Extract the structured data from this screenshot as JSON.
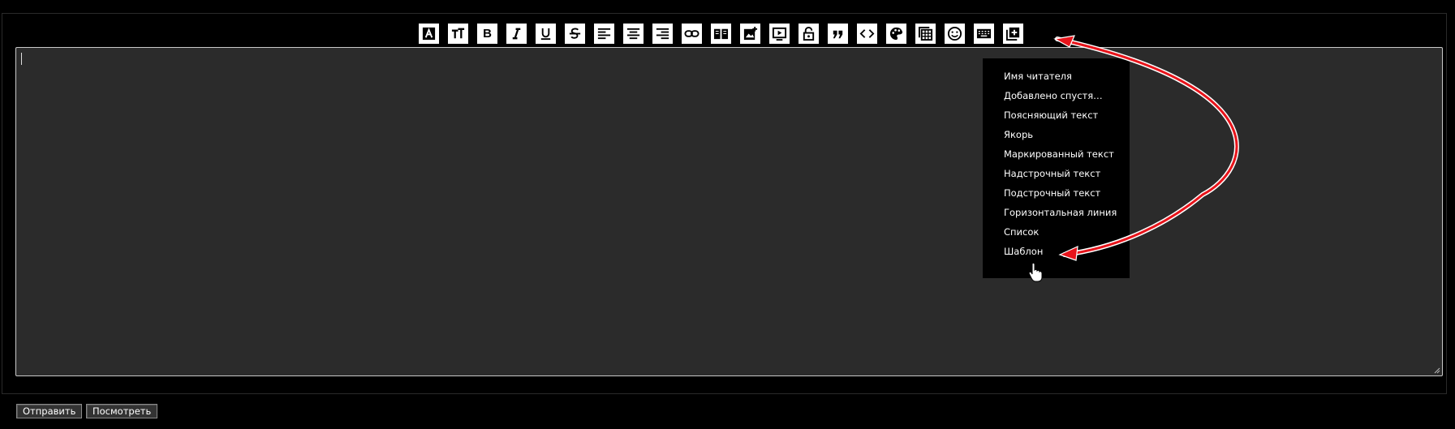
{
  "toolbar": {
    "icons": [
      "font-color-icon",
      "text-size-icon",
      "bold-icon",
      "italic-icon",
      "underline-icon",
      "strikethrough-icon",
      "align-left-icon",
      "align-center-icon",
      "align-right-icon",
      "link-icon",
      "book-icon",
      "image-add-icon",
      "video-icon",
      "lock-icon",
      "quote-icon",
      "code-icon",
      "palette-icon",
      "table-icon",
      "emoji-icon",
      "keyboard-icon",
      "more-add-icon"
    ],
    "bold_glyph": "B",
    "italic_glyph": "I",
    "underline_glyph": "U",
    "strike_glyph": "S"
  },
  "menu": {
    "items": [
      "Имя читателя",
      "Добавлено спустя…",
      "Поясняющий текст",
      "Якорь",
      "Маркированный текст",
      "Надстрочный текст",
      "Подстрочный текст",
      "Горизонтальная линия",
      "Список",
      "Шаблон"
    ]
  },
  "buttons": {
    "submit": "Отправить",
    "preview": "Посмотреть"
  },
  "colors": {
    "background": "#000000",
    "editor_bg": "#2b2b2b",
    "arrow": "#e8141b"
  }
}
